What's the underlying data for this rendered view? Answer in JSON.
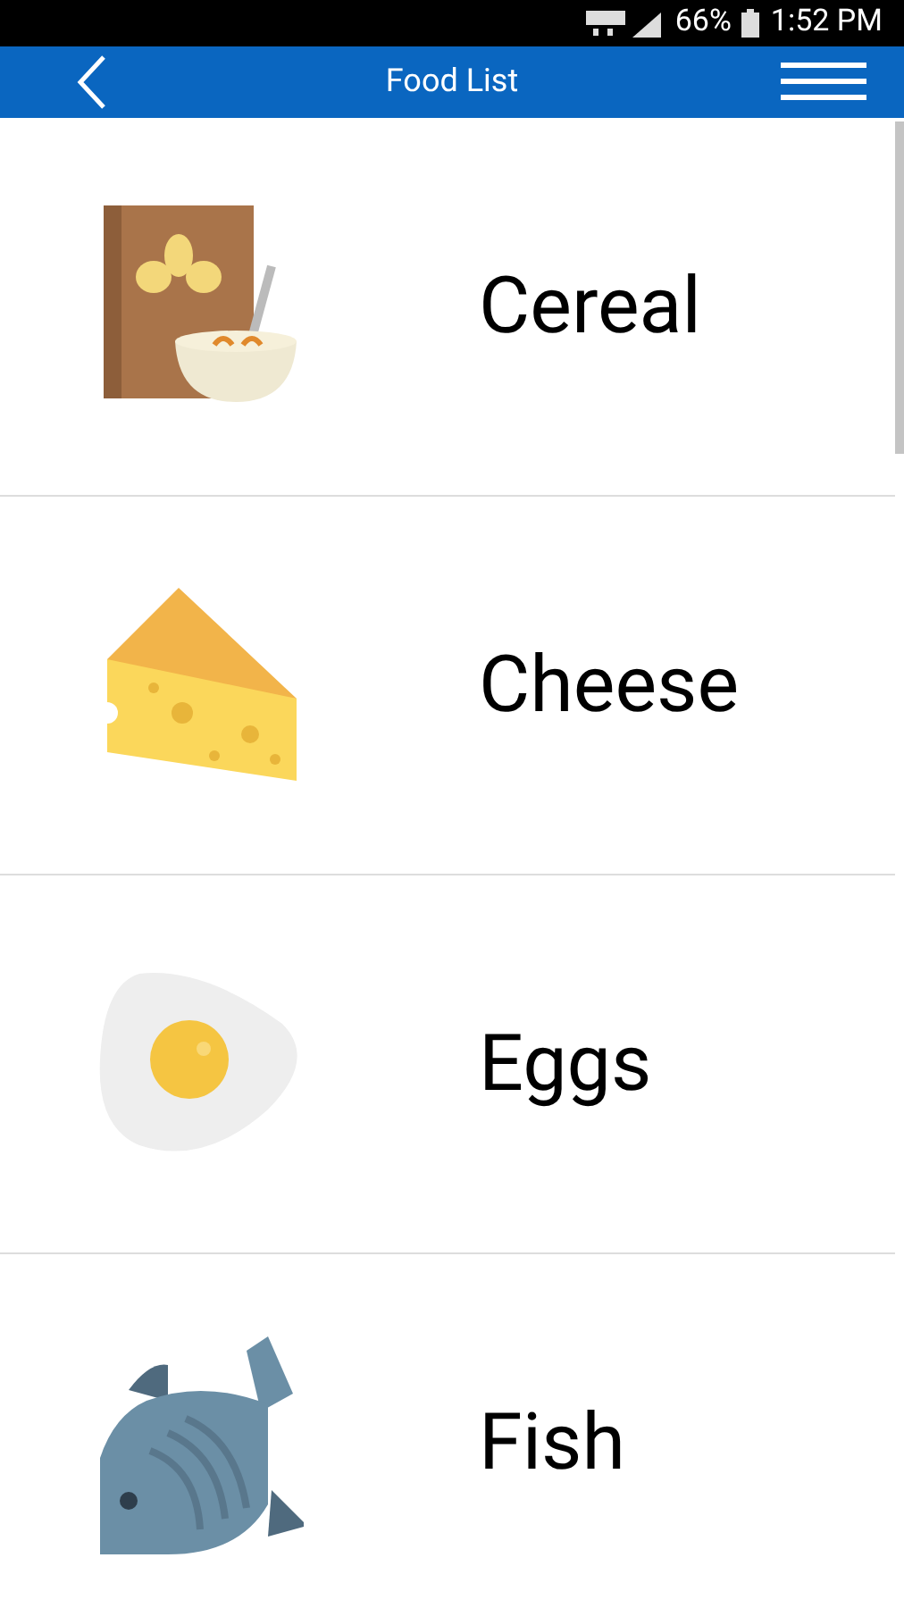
{
  "status_bar": {
    "battery": "66%",
    "time": "1:52 PM"
  },
  "app_bar": {
    "title": "Food List"
  },
  "items": [
    {
      "label": "Cereal",
      "kind": "cereal"
    },
    {
      "label": "Cheese",
      "kind": "cheese"
    },
    {
      "label": "Eggs",
      "kind": "egg"
    },
    {
      "label": "Fish",
      "kind": "fish"
    }
  ]
}
